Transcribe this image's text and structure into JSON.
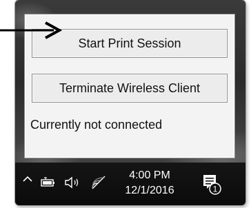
{
  "popup": {
    "start_button": "Start Print Session",
    "terminate_button": "Terminate Wireless Client",
    "status_text": "Currently not connected"
  },
  "taskbar": {
    "time": "4:00 PM",
    "date": "12/1/2016",
    "notification_count": "1",
    "icons": [
      "chevron-up-icon",
      "battery-icon",
      "volume-icon",
      "wifi-icon",
      "action-center-icon"
    ]
  },
  "annotation": {
    "arrow_color": "#000000"
  }
}
